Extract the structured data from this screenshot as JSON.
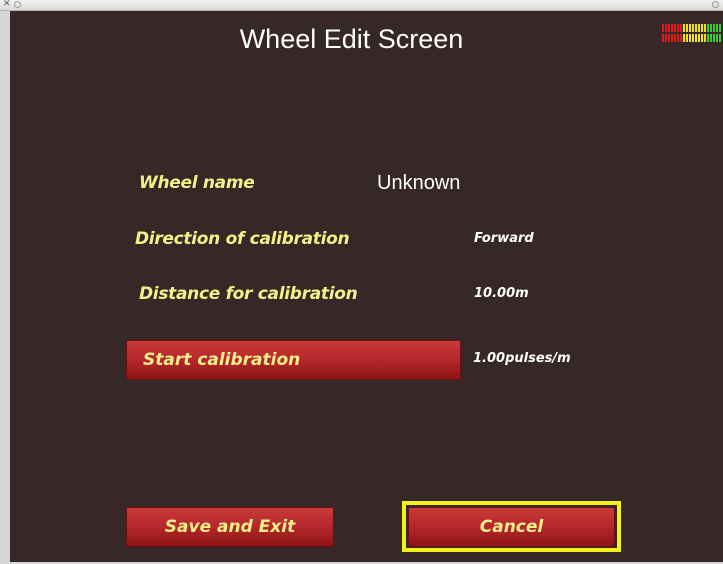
{
  "window": {
    "close_glyph": "✕"
  },
  "screen": {
    "title": "Wheel Edit Screen"
  },
  "fields": {
    "wheel_name_label": "Wheel name",
    "wheel_name_value": "Unknown",
    "direction_label": "Direction of calibration",
    "direction_value": "Forward",
    "distance_label": "Distance for calibration",
    "distance_value": "10.00m",
    "pulses_value": "1.00pulses/m"
  },
  "buttons": {
    "start_calibration": "Start calibration",
    "save_and_exit": "Save and Exit",
    "cancel": "Cancel"
  },
  "colors": {
    "background": "#352826",
    "label_yellow": "#f5ef8a",
    "button_red": "#b4272a",
    "focus_yellow": "#f4f01a",
    "meter_red": "#e01a1a",
    "meter_yellow": "#f2e21a",
    "meter_green": "#33cc33"
  },
  "icons": {
    "signal_meter": "signal-level-meter-icon"
  }
}
